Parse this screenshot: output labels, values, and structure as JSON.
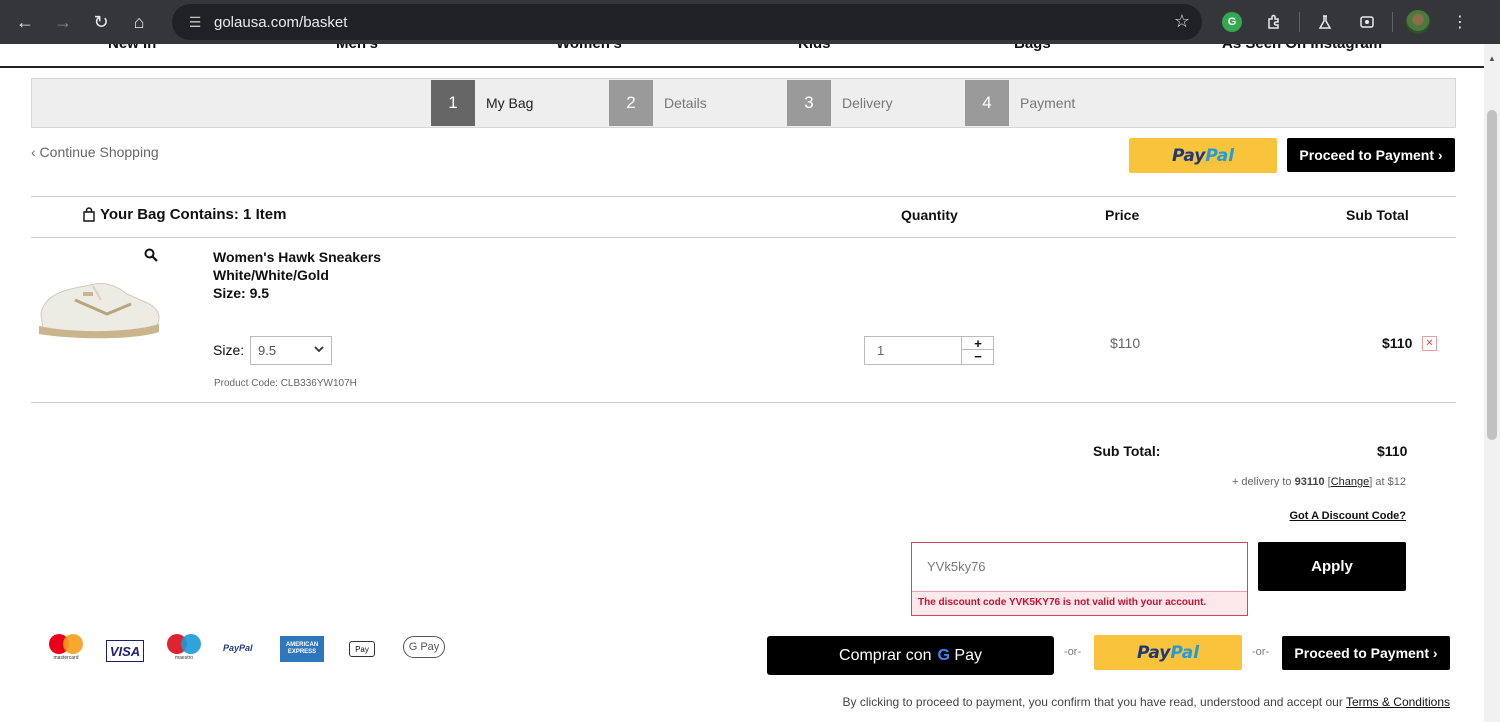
{
  "browser": {
    "url": "golausa.com/basket",
    "back_icon": "←",
    "forward_icon": "→",
    "reload_icon": "↻",
    "home_icon": "⌂",
    "site_settings_icon": "☰",
    "star_icon": "☆",
    "menu_icon": "⋮"
  },
  "site_nav": [
    "New In",
    "Men's",
    "Women's",
    "Kids",
    "Bags",
    "As Seen On Instagram"
  ],
  "steps": [
    {
      "num": "1",
      "label": "My Bag"
    },
    {
      "num": "2",
      "label": "Details"
    },
    {
      "num": "3",
      "label": "Delivery"
    },
    {
      "num": "4",
      "label": "Payment"
    }
  ],
  "active_step": 1,
  "continue_shopping": "‹ Continue Shopping",
  "paypal": {
    "part1": "Pay",
    "part2": "Pal"
  },
  "proceed_label": "Proceed to Payment ›",
  "table": {
    "bag_title": "Your Bag Contains: 1 Item",
    "col_quantity": "Quantity",
    "col_price": "Price",
    "col_subtotal": "Sub Total"
  },
  "item": {
    "name": "Women's Hawk Sneakers",
    "color": "White/White/Gold",
    "size_line": "Size: 9.5",
    "size_label": "Size:",
    "size_value": "9.5",
    "product_code": "Product Code: CLB336YW107H",
    "quantity": "1",
    "price": "$110",
    "subtotal": "$110"
  },
  "summary": {
    "subtotal_label": "Sub Total:",
    "subtotal_value": "$110",
    "delivery_prefix": "+ delivery to",
    "zip": "93110",
    "change": "Change",
    "delivery_suffix": "at $12",
    "discount_link": "Got A Discount Code?"
  },
  "discount": {
    "code": "YVk5ky76",
    "error": "The discount code YVK5KY76 is not valid with your account.",
    "apply": "Apply"
  },
  "payment_icons": {
    "mastercard": "mastercard",
    "visa": "VISA",
    "maestro": "maestro",
    "paypal": "PayPal",
    "amex": "AMERICAN EXPRESS",
    "applepay": "Pay",
    "googlepay": "G Pay"
  },
  "gpay_button": {
    "text": "Comprar con",
    "g": "G",
    "pay": "Pay"
  },
  "or": "-or-",
  "terms": {
    "text": "By clicking to proceed to payment, you confirm that you have read, understood and accept our",
    "link": "Terms & Conditions"
  }
}
